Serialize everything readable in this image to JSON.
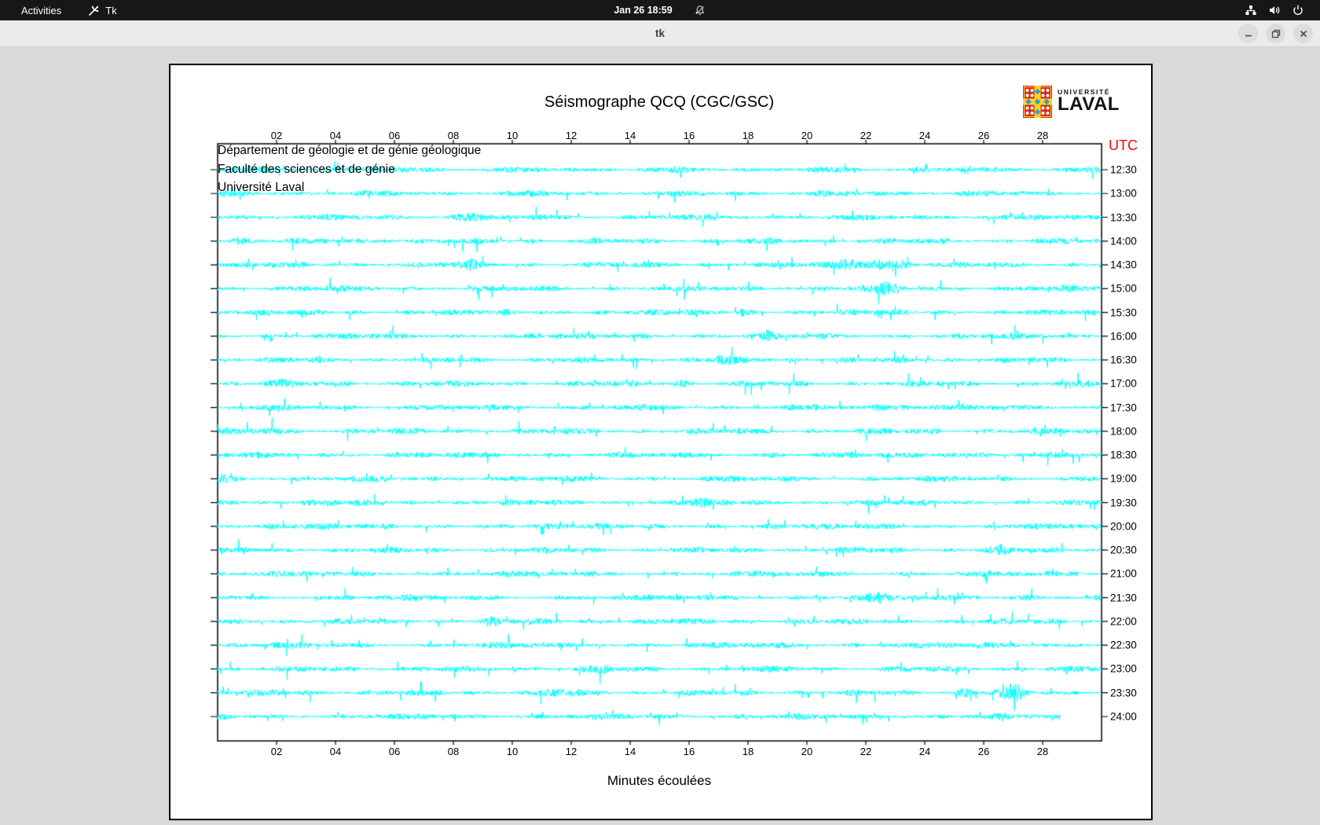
{
  "top_bar": {
    "activities_label": "Activities",
    "app_name": "Tk",
    "clock": "Jan 26 18:59",
    "bell_icon": "notifications-muted",
    "tray_icons": [
      "network",
      "volume",
      "power"
    ]
  },
  "window": {
    "title": "tk"
  },
  "seismograph": {
    "header_lines": [
      "Département de géologie et de génie géologique",
      "Faculté des sciences et de génie",
      "Université Laval"
    ],
    "title": "Séismographe QCQ (CGC/GSC)",
    "logo": {
      "line1": "UNIVERSITÉ",
      "line2": "LAVAL"
    },
    "utc_label": "UTC",
    "x_axis_title": "Minutes écoulées",
    "x_ticks": [
      "02",
      "04",
      "06",
      "08",
      "10",
      "12",
      "14",
      "16",
      "18",
      "20",
      "22",
      "24",
      "26",
      "28"
    ],
    "trace_times": [
      "12:30",
      "13:00",
      "13:30",
      "14:00",
      "14:30",
      "15:00",
      "15:30",
      "16:00",
      "16:30",
      "17:00",
      "17:30",
      "18:00",
      "18:30",
      "19:00",
      "19:30",
      "20:00",
      "20:30",
      "21:00",
      "21:30",
      "22:00",
      "22:30",
      "23:00",
      "23:30",
      "24:00"
    ],
    "x_range_minutes": [
      0,
      30
    ],
    "last_trace_end_minute": 28.6,
    "colors": {
      "trace": "#00ffff",
      "axis": "#000000",
      "utc": "#ff0000"
    },
    "events": [
      {
        "time": "13:30",
        "minute": 8.3,
        "amp": 1.6,
        "sigma": 0.3
      },
      {
        "time": "14:00",
        "minute": 0.9,
        "amp": 1.2,
        "sigma": 0.35
      },
      {
        "time": "14:00",
        "minute": 5.6,
        "amp": 0.9,
        "sigma": 0.3
      },
      {
        "time": "14:30",
        "minute": 21.9,
        "amp": 3.2,
        "sigma": 0.5
      },
      {
        "time": "14:30",
        "minute": 23.1,
        "amp": 2.2,
        "sigma": 0.4
      },
      {
        "time": "14:30",
        "minute": 8.5,
        "amp": 1.0,
        "sigma": 0.3
      },
      {
        "time": "15:00",
        "minute": 22.6,
        "amp": 1.4,
        "sigma": 0.3
      },
      {
        "time": "15:30",
        "minute": 17.8,
        "amp": 1.8,
        "sigma": 0.15
      },
      {
        "time": "16:00",
        "minute": 18.6,
        "amp": 1.2,
        "sigma": 0.15
      },
      {
        "time": "16:30",
        "minute": 17.2,
        "amp": 1.3,
        "sigma": 0.3
      },
      {
        "time": "17:00",
        "minute": 15.7,
        "amp": 1.6,
        "sigma": 0.15
      },
      {
        "time": "17:00",
        "minute": 2.0,
        "amp": 1.0,
        "sigma": 0.2
      },
      {
        "time": "17:30",
        "minute": 23.2,
        "amp": 1.5,
        "sigma": 0.6
      },
      {
        "time": "18:00",
        "minute": 1.7,
        "amp": 1.0,
        "sigma": 0.3
      },
      {
        "time": "18:30",
        "minute": 18.8,
        "amp": 1.3,
        "sigma": 0.15
      },
      {
        "time": "18:30",
        "minute": 25.0,
        "amp": 1.2,
        "sigma": 0.5
      },
      {
        "time": "19:00",
        "minute": 0.3,
        "amp": 1.2,
        "sigma": 0.25
      },
      {
        "time": "19:30",
        "minute": 16.2,
        "amp": 1.5,
        "sigma": 0.25
      },
      {
        "time": "19:30",
        "minute": 0.5,
        "amp": 1.3,
        "sigma": 0.3
      },
      {
        "time": "20:00",
        "minute": 27.4,
        "amp": 1.6,
        "sigma": 0.2
      },
      {
        "time": "20:30",
        "minute": 26.3,
        "amp": 1.2,
        "sigma": 0.3
      },
      {
        "time": "21:30",
        "minute": 22.3,
        "amp": 1.1,
        "sigma": 0.3
      },
      {
        "time": "21:30",
        "minute": 27.3,
        "amp": 1.2,
        "sigma": 0.25
      },
      {
        "time": "22:00",
        "minute": 9.3,
        "amp": 1.0,
        "sigma": 0.15
      },
      {
        "time": "22:30",
        "minute": 22.9,
        "amp": 1.0,
        "sigma": 0.3
      },
      {
        "time": "23:00",
        "minute": 13.0,
        "amp": 0.9,
        "sigma": 0.25
      },
      {
        "time": "23:30",
        "minute": 26.9,
        "amp": 2.0,
        "sigma": 0.3
      },
      {
        "time": "23:30",
        "minute": 25.4,
        "amp": 1.2,
        "sigma": 0.2
      },
      {
        "time": "23:30",
        "minute": 11.5,
        "amp": 1.0,
        "sigma": 0.3
      }
    ]
  }
}
